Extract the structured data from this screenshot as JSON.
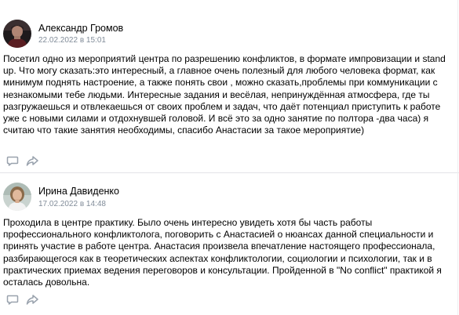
{
  "reviews": [
    {
      "author": "Александр Громов",
      "date": "22.02.2022 в 15:01",
      "text": "Посетил одно из мероприятий центра по разрешению конфликтов, в формате импровизации и stand up. Что могу сказать:это интересный, а главное очень полезный для любого человека формат, как минимум поднять настроение, а также понять свои , можно сказать,проблемы при коммуникации с незнакомыми тебе людьми. Интересные задания и весёлая, непринуждённая атмосфера, где ты разгружаешься и отвлекаешься от своих проблем и задач, что даёт потенциал приступить к работе уже с новыми силами и отдохнувшей головой. И всё это за одно занятие по полтора -два часа) я считаю что такие занятия необходимы, спасибо Анастасии за такое мероприятие)",
      "avatar_icon": "avatar-photo-man",
      "comment_icon": "comment-icon",
      "share_icon": "share-icon"
    },
    {
      "author": "Ирина Давиденко",
      "date": "17.02.2022 в 14:48",
      "text": "Проходила в центре практику. Было очень интересно увидеть хотя бы часть работы профессионального конфликтолога, поговорить с Анастасией о нюансах данной специальности и принять участие в работе центра. Анастасия произвела впечатление настоящего профессионала, разбирающегося как в теоретических аспектах конфликтологии, социологии и психологии, так и в практических приемах ведения переговоров и консультации. Пройденной в \"No conflict\" практикой я осталась довольна.",
      "avatar_icon": "avatar-photo-woman",
      "comment_icon": "comment-icon",
      "share_icon": "share-icon"
    }
  ],
  "colors": {
    "text": "#000000",
    "date": "#818c99",
    "icon": "#99a2ad",
    "divider": "#e3e4e8"
  }
}
